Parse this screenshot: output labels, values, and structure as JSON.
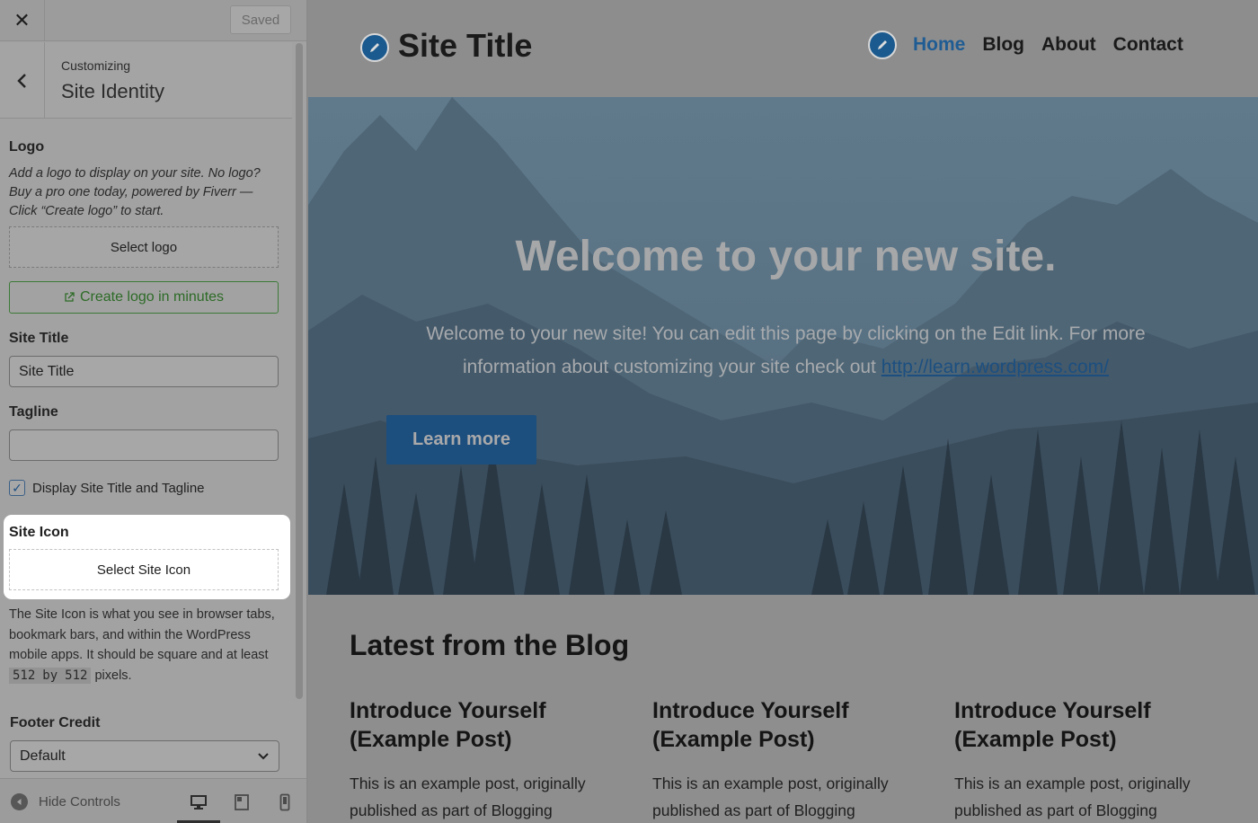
{
  "customizer": {
    "close_icon": "close-icon",
    "saved_label": "Saved",
    "breadcrumb": "Customizing",
    "section_title": "Site Identity",
    "logo": {
      "label": "Logo",
      "description": "Add a logo to display on your site. No logo? Buy a pro one today, powered by Fiverr — Click “Create logo” to start.",
      "select_label": "Select logo",
      "create_label": "Create logo in minutes"
    },
    "site_title": {
      "label": "Site Title",
      "value": "Site Title"
    },
    "tagline": {
      "label": "Tagline",
      "value": ""
    },
    "display_checkbox": {
      "label": "Display Site Title and Tagline",
      "checked": true
    },
    "site_icon": {
      "label": "Site Icon",
      "select_label": "Select Site Icon",
      "desc_before": "The Site Icon is what you see in browser tabs, bookmark bars, and within the WordPress mobile apps. It should be square and at least",
      "size_w": "512",
      "by": "by",
      "size_h": "512",
      "desc_after": "pixels."
    },
    "footer_credit": {
      "label": "Footer Credit",
      "value": "Default"
    },
    "hide_controls": "Hide Controls",
    "device_icons": [
      "desktop-icon",
      "tablet-icon",
      "mobile-icon"
    ]
  },
  "preview": {
    "site_title": "Site Title",
    "nav": [
      "Home",
      "Blog",
      "About",
      "Contact"
    ],
    "hero": {
      "title": "Welcome to your new site.",
      "text": "Welcome to your new site! You can edit this page by clicking on the Edit link. For more information about customizing your site check out",
      "link": "http://learn.wordpress.com/",
      "button": "Learn more"
    },
    "blog_heading": "Latest from the Blog",
    "posts": [
      {
        "title": "Introduce Yourself (Example Post)",
        "excerpt": "This is an example post, originally published as part of Blogging"
      },
      {
        "title": "Introduce Yourself (Example Post)",
        "excerpt": "This is an example post, originally published as part of Blogging"
      },
      {
        "title": "Introduce Yourself (Example Post)",
        "excerpt": "This is an example post, originally published as part of Blogging"
      }
    ]
  },
  "colors": {
    "accent": "#1f5c93",
    "green": "#2d6b27",
    "highlight": "#ffffff"
  }
}
